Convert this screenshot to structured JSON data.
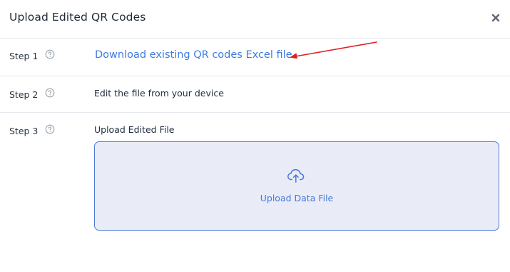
{
  "dialog": {
    "title": "Upload Edited QR Codes",
    "close_icon": "close-icon"
  },
  "steps": [
    {
      "label": "Step 1",
      "action_text": "Download existing QR codes Excel file"
    },
    {
      "label": "Step 2",
      "text": "Edit the file from your device"
    },
    {
      "label": "Step 3",
      "text": "Upload Edited File"
    }
  ],
  "upload": {
    "icon": "cloud-upload-icon",
    "button_text": "Upload Data File"
  },
  "colors": {
    "link": "#3f7be0",
    "dropzone_bg": "#e9ecf7",
    "dropzone_border": "#4f7ad6",
    "annotation_arrow": "#e02020"
  }
}
